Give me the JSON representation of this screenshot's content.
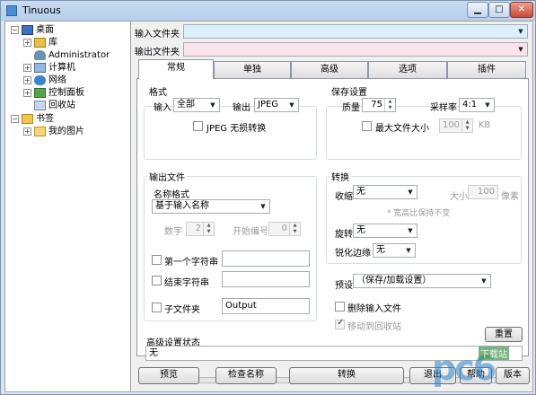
{
  "window": {
    "title": "Tinuous"
  },
  "tree": {
    "items": [
      {
        "label": "桌面"
      },
      {
        "label": "库"
      },
      {
        "label": "Administrator"
      },
      {
        "label": "计算机"
      },
      {
        "label": "网络"
      },
      {
        "label": "控制面板"
      },
      {
        "label": "回收站"
      },
      {
        "label": "书签"
      },
      {
        "label": "我的图片"
      }
    ]
  },
  "input_folder": {
    "label": "输入文件夹",
    "value": ""
  },
  "output_folder": {
    "label": "输出文件夹",
    "value": ""
  },
  "tabs": [
    {
      "label": "常规"
    },
    {
      "label": "单独"
    },
    {
      "label": "高级"
    },
    {
      "label": "选项"
    },
    {
      "label": "插件"
    }
  ],
  "format": {
    "title": "格式",
    "input_label": "输入",
    "input_value": "全部",
    "output_label": "输出",
    "output_value": "JPEG",
    "lossless_label": "JPEG 无损转换"
  },
  "save": {
    "title": "保存设置",
    "quality_label": "质量",
    "quality_value": "75",
    "sampling_label": "采样率",
    "sampling_value": "4:1",
    "maxsize_label": "最大文件大小",
    "maxsize_value": "100",
    "maxsize_unit": "KB"
  },
  "output_file": {
    "title": "输出文件",
    "name_format_label": "名称格式",
    "name_format_value": "基于输入名称",
    "digits_label": "数字",
    "digits_value": "2",
    "start_label": "开始编号",
    "start_value": "0",
    "first_string_label": "第一个字符串",
    "end_string_label": "结束字符串",
    "subfolder_label": "子文件夹",
    "subfolder_value": "Output"
  },
  "convert": {
    "title": "转换",
    "shrink_label": "收缩",
    "shrink_value": "无",
    "size_label": "大小",
    "size_value": "100",
    "size_unit": "像素",
    "aspect_note": "* 宽高比保持不变",
    "rotate_label": "旋转",
    "rotate_value": "无",
    "sharpen_label": "锐化边缘",
    "sharpen_value": "无"
  },
  "preset": {
    "label": "预设",
    "value": "（保存/加载设置）",
    "delete_input_label": "删除输入文件",
    "recycle_label": "移动到回收站"
  },
  "advanced_status": {
    "label": "高级设置状态",
    "value": "无",
    "reset_label": "重置"
  },
  "progress": {
    "percent": 0
  },
  "buttons": {
    "preview": "预览",
    "check_names": "检查名称",
    "convert": "转换",
    "exit": "退出",
    "help": "帮助",
    "version": "版本"
  },
  "watermark": {
    "text": "pc6",
    "sub": "下载站"
  },
  "colors": {
    "input_bg": "#dcf0fb",
    "output_bg": "#fbe3ea",
    "progress": "#5fb85a"
  }
}
